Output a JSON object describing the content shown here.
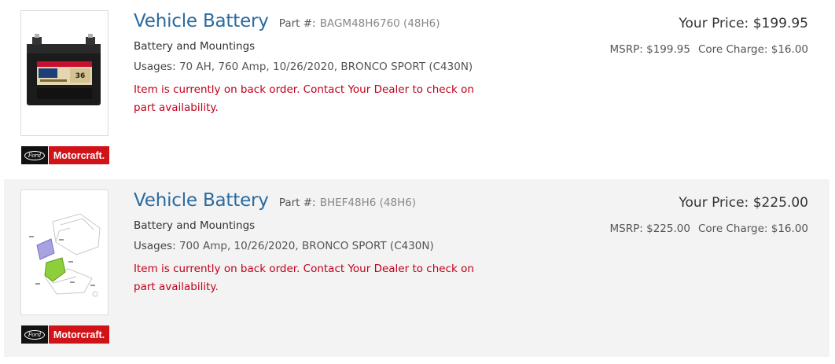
{
  "results": [
    {
      "title": "Vehicle Battery",
      "part_label": "Part #:",
      "part_number": "BAGM48H6760 (48H6)",
      "description": "Battery and Mountings",
      "usages_label": "Usages:",
      "usages_value": "70 AH, 760 Amp, 10/26/2020, BRONCO SPORT (C430N)",
      "stock_message": "Item is currently on back order. Contact Your Dealer to check on part availability.",
      "your_price": "Your Price: $199.95",
      "msrp": "MSRP:  $199.95",
      "core_charge": "Core Charge: $16.00",
      "image_type": "battery-photo",
      "brand_ford": "Ford",
      "brand_motorcraft": "Motorcraft."
    },
    {
      "title": "Vehicle Battery",
      "part_label": "Part #:",
      "part_number": "BHEF48H6 (48H6)",
      "description": "Battery and Mountings",
      "usages_label": "Usages:",
      "usages_value": "700 Amp, 10/26/2020, BRONCO SPORT (C430N)",
      "stock_message": "Item is currently on back order. Contact Your Dealer to check on part availability.",
      "your_price": "Your Price: $225.00",
      "msrp": "MSRP:  $225.00",
      "core_charge": "Core Charge: $16.00",
      "image_type": "parts-diagram",
      "brand_ford": "Ford",
      "brand_motorcraft": "Motorcraft."
    }
  ],
  "colors": {
    "title": "#2b6a9e",
    "warning": "#c0001b",
    "motorcraft": "#d01318",
    "alt_row": "#f3f3f3"
  }
}
